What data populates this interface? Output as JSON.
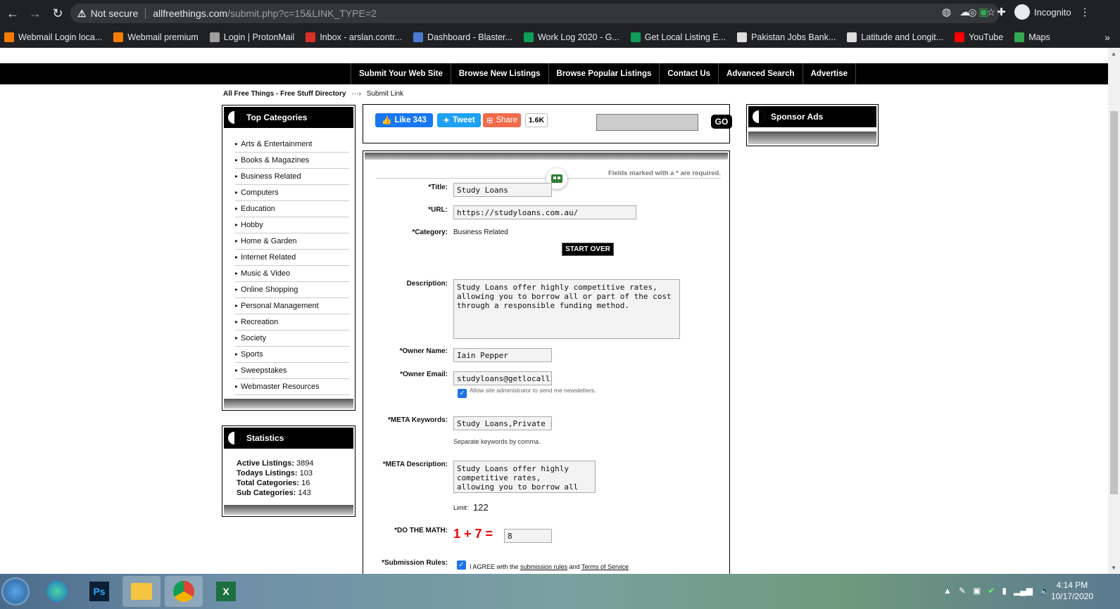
{
  "browser": {
    "security": "Not secure",
    "url_host": "allfreethings.com",
    "url_path": "/submit.php?c=15&LINK_TYPE=2",
    "profile": "Incognito"
  },
  "bookmarks": [
    {
      "label": "Webmail Login loca...",
      "color": "#f57c00"
    },
    {
      "label": "Webmail premium",
      "color": "#f57c00"
    },
    {
      "label": "Login | ProtonMail",
      "color": "#9e9e9e"
    },
    {
      "label": "Inbox - arslan.contr...",
      "color": "#d93025"
    },
    {
      "label": "Dashboard - Blaster...",
      "color": "#4a7bd0"
    },
    {
      "label": "Work Log 2020 - G...",
      "color": "#0f9d58"
    },
    {
      "label": "Get Local Listing E...",
      "color": "#0f9d58"
    },
    {
      "label": "Pakistan Jobs Bank...",
      "color": "#dddddd"
    },
    {
      "label": "Latitude and Longit...",
      "color": "#dddddd"
    },
    {
      "label": "YouTube",
      "color": "#ff0000"
    },
    {
      "label": "Maps",
      "color": "#34a853"
    }
  ],
  "nav": [
    "Submit Your Web Site",
    "Browse New Listings",
    "Browse Popular Listings",
    "Contact Us",
    "Advanced Search",
    "Advertise"
  ],
  "breadcrumb": {
    "home": "All Free Things - Free Stuff Directory",
    "sep": "···›",
    "current": "Submit Link"
  },
  "categories": {
    "title": "Top Categories",
    "items": [
      "Arts & Entertainment",
      "Books & Magazines",
      "Business Related",
      "Computers",
      "Education",
      "Hobby",
      "Home & Garden",
      "Internet Related",
      "Music & Video",
      "Online Shopping",
      "Personal Management",
      "Recreation",
      "Society",
      "Sports",
      "Sweepstakes",
      "Webmaster Resources"
    ]
  },
  "statistics": {
    "title": "Statistics",
    "rows": [
      {
        "label": "Active Listings:",
        "value": "3894"
      },
      {
        "label": "Todays Listings:",
        "value": "103"
      },
      {
        "label": "Total Categories:",
        "value": "16"
      },
      {
        "label": "Sub Categories:",
        "value": "143"
      }
    ]
  },
  "social": {
    "like": "Like 343",
    "tweet": "Tweet",
    "share": "Share",
    "count": "1.6K",
    "go": "GO"
  },
  "sponsor": {
    "title": "Sponsor Ads"
  },
  "form": {
    "required_note": "Fields marked with a * are required.",
    "title_label": "*Title:",
    "title_value": "Study Loans",
    "url_label": "*URL:",
    "url_value": "https://studyloans.com.au/",
    "category_label": "*Category:",
    "category_value": "Business Related",
    "start_over": "START OVER",
    "description_label": "Description:",
    "description_value": "Study Loans offer highly competitive rates, allowing you to borrow all or part of the cost through a responsible funding method.",
    "owner_name_label": "*Owner Name:",
    "owner_name_value": "Iain Pepper",
    "owner_email_label": "*Owner Email:",
    "owner_email_value": "studyloans@getlocallistin",
    "newsletter_note": "Allow site administrator to send me newsletters.",
    "meta_keywords_label": "*META Keywords:",
    "meta_keywords_value": "Study Loans,Private stud",
    "keywords_note": "Separate keywords by comma.",
    "meta_description_label": "*META Description:",
    "meta_description_value": "Study Loans offer highly competitive rates, allowing you to borrow all or part of the cost",
    "limit_label": "Limit:",
    "limit_value": "122",
    "math_label": "*DO THE MATH:",
    "math_question": "1 + 7 =",
    "math_answer": "8",
    "rules_label": "*Submission Rules:",
    "rules_text_a": "I AGREE with the",
    "rules_link1": "submission rules",
    "rules_text_b": "and",
    "rules_link2": "Terms of Service"
  },
  "taskbar": {
    "time": "4:14 PM",
    "date": "10/17/2020"
  }
}
